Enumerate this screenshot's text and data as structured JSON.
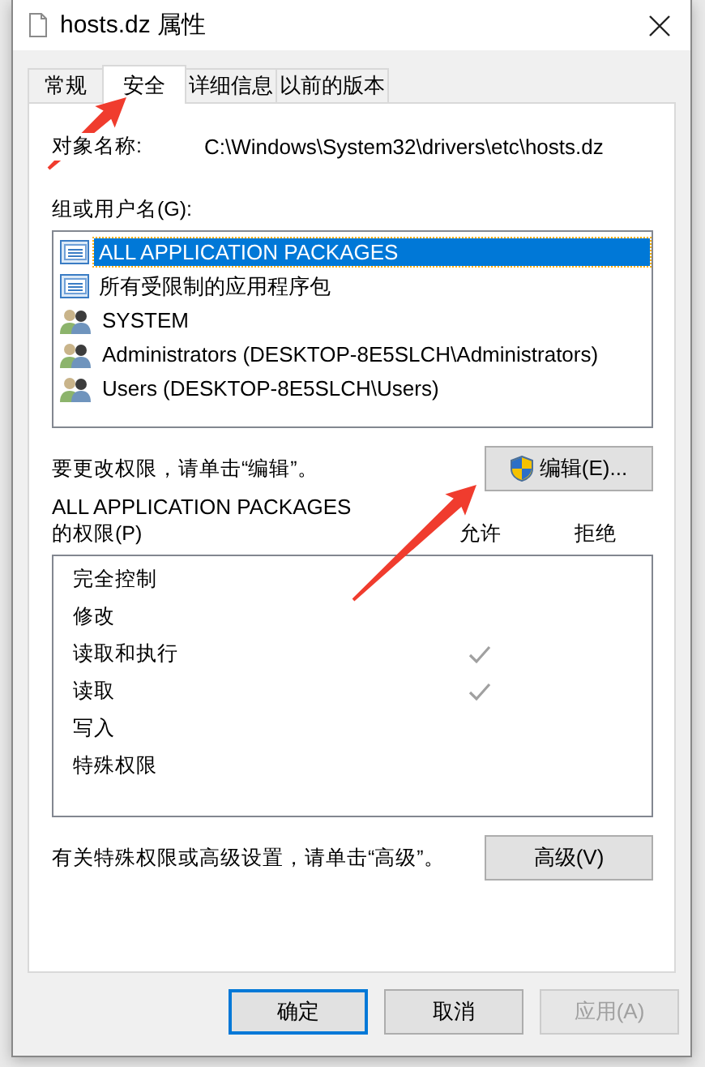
{
  "window": {
    "title": "hosts.dz 属性"
  },
  "tabs": [
    {
      "label": "常规",
      "selected": false
    },
    {
      "label": "安全",
      "selected": true
    },
    {
      "label": "详细信息",
      "selected": false
    },
    {
      "label": "以前的版本",
      "selected": false
    }
  ],
  "object_name": {
    "label": "对象名称:",
    "value": "C:\\Windows\\System32\\drivers\\etc\\hosts.dz"
  },
  "groups": {
    "label": "组或用户名(G):",
    "items": [
      {
        "name": "ALL APPLICATION PACKAGES",
        "kind": "package",
        "selected": true
      },
      {
        "name": "所有受限制的应用程序包",
        "kind": "package",
        "selected": false
      },
      {
        "name": "SYSTEM",
        "kind": "users",
        "selected": false
      },
      {
        "name": "Administrators (DESKTOP-8E5SLCH\\Administrators)",
        "kind": "users",
        "selected": false
      },
      {
        "name": "Users (DESKTOP-8E5SLCH\\Users)",
        "kind": "users",
        "selected": false
      }
    ]
  },
  "edit_hint": "要更改权限，请单击“编辑”。",
  "edit_button": "编辑(E)...",
  "permissions": {
    "title": "ALL APPLICATION PACKAGES",
    "label": "的权限(P)",
    "columns": [
      "允许",
      "拒绝"
    ],
    "rows": [
      {
        "name": "完全控制",
        "allow": false,
        "deny": false
      },
      {
        "name": "修改",
        "allow": false,
        "deny": false
      },
      {
        "name": "读取和执行",
        "allow": true,
        "deny": false
      },
      {
        "name": "读取",
        "allow": true,
        "deny": false
      },
      {
        "name": "写入",
        "allow": false,
        "deny": false
      },
      {
        "name": "特殊权限",
        "allow": false,
        "deny": false
      }
    ]
  },
  "advanced_hint": "有关特殊权限或高级设置，请单击“高级”。",
  "advanced_button": "高级(V)",
  "buttons": [
    {
      "label": "确定",
      "kind": "default",
      "disabled": false
    },
    {
      "label": "取消",
      "kind": "normal",
      "disabled": false
    },
    {
      "label": "应用(A)",
      "kind": "normal",
      "disabled": true
    }
  ],
  "annotations": [
    {
      "kind": "arrow"
    },
    {
      "kind": "arrow"
    }
  ]
}
